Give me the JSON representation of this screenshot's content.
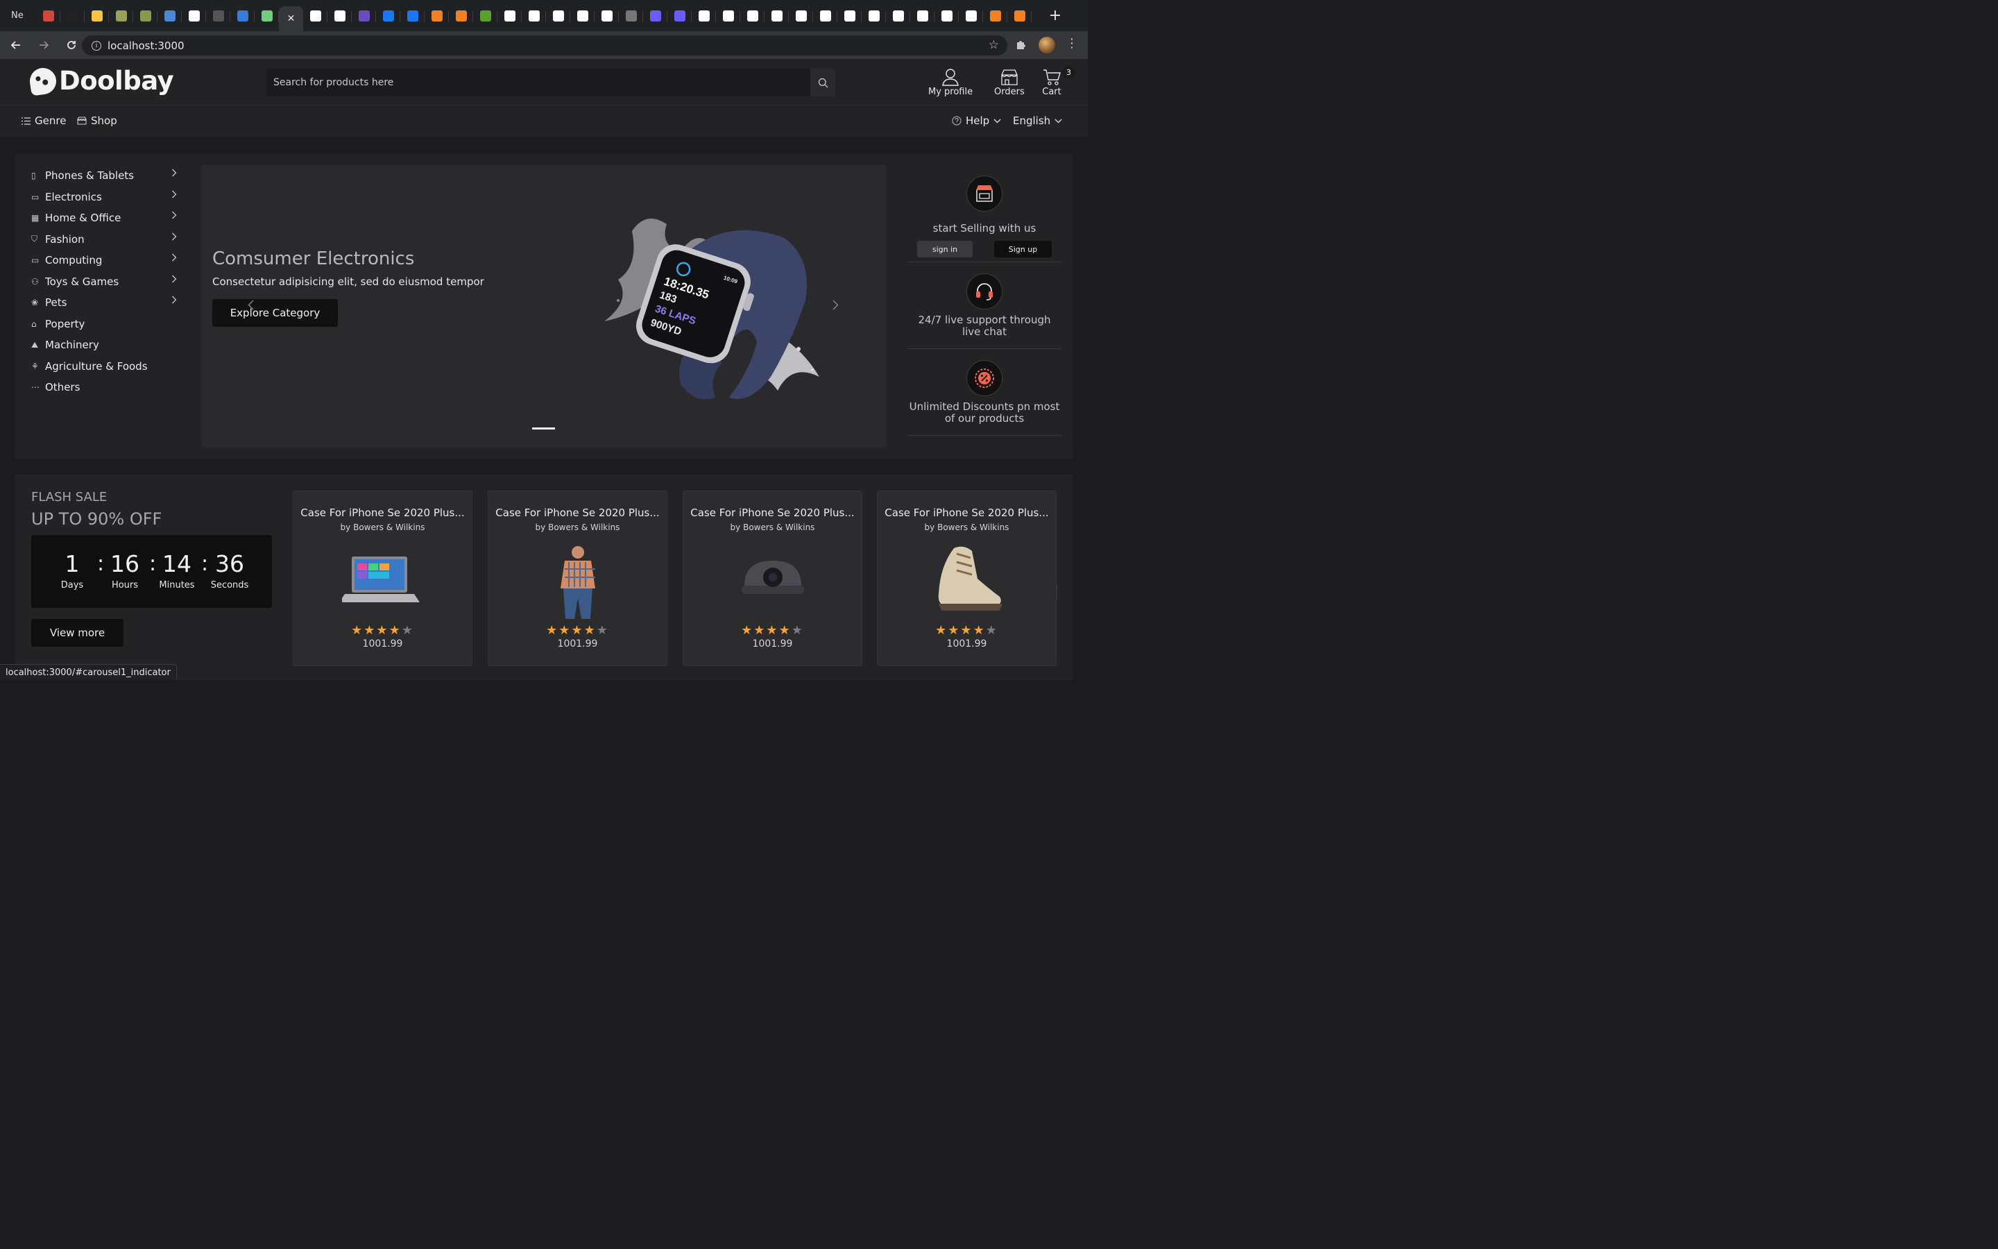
{
  "browser": {
    "first_tab_label": "Ne",
    "url": "localhost:3000",
    "status_url": "localhost:3000/#carousel1_indicator",
    "tab_favicon_colors": [
      "#d44638",
      "#222",
      "#f6c343",
      "#9aa05a",
      "#8b9a4a",
      "#4a8ad4",
      "#ffffff",
      "#555",
      "#3a7bd5",
      "#6fcf7c",
      "#ffffff",
      "#ffffff",
      "#ffffff",
      "#6a4bc4",
      "#1877f2",
      "#1877f2",
      "#f48024",
      "#f48024",
      "#5aa02c",
      "#ffffff",
      "#ffffff",
      "#ffffff",
      "#ffffff",
      "#ffffff",
      "#777",
      "#6b5bff",
      "#6b5bff",
      "#ffffff",
      "#ffffff",
      "#ffffff",
      "#ffffff",
      "#ffffff",
      "#ffffff",
      "#ffffff",
      "#ffffff",
      "#ffffff",
      "#ffffff",
      "#ffffff",
      "#ffffff",
      "#f48024",
      "#f48024"
    ]
  },
  "site": {
    "brand": "Doolbay",
    "search_placeholder": "Search for products here",
    "header": {
      "profile": "My profile",
      "orders": "Orders",
      "cart": "Cart",
      "cart_count": "3"
    },
    "subnav": {
      "genre": "Genre",
      "shop": "Shop",
      "help": "Help",
      "language": "English"
    }
  },
  "categories": [
    {
      "label": "Phones & Tablets",
      "icon": "phone-icon",
      "glyph": "▯",
      "has_sub": true
    },
    {
      "label": "Electronics",
      "icon": "monitor-icon",
      "glyph": "▭",
      "has_sub": true
    },
    {
      "label": "Home & Office",
      "icon": "building-icon",
      "glyph": "▦",
      "has_sub": true
    },
    {
      "label": "Fashion",
      "icon": "shirt-icon",
      "glyph": "⛉",
      "has_sub": true
    },
    {
      "label": "Computing",
      "icon": "laptop-icon",
      "glyph": "▭",
      "has_sub": true
    },
    {
      "label": "Toys & Games",
      "icon": "gamepad-icon",
      "glyph": "⚇",
      "has_sub": true
    },
    {
      "label": "Pets",
      "icon": "paw-icon",
      "glyph": "❀",
      "has_sub": true
    },
    {
      "label": "Poperty",
      "icon": "home-icon",
      "glyph": "⌂",
      "has_sub": false
    },
    {
      "label": "Machinery",
      "icon": "machine-icon",
      "glyph": "⛰",
      "has_sub": false
    },
    {
      "label": "Agriculture & Foods",
      "icon": "plant-icon",
      "glyph": "⚘",
      "has_sub": false
    },
    {
      "label": "Others",
      "icon": "dots-icon",
      "glyph": "⋯",
      "has_sub": false
    }
  ],
  "hero": {
    "title": "Comsumer Electronics",
    "subtitle": "Consectetur adipisicing elit, sed do eiusmod tempor",
    "cta": "Explore Category",
    "watch_readout": [
      "18:20.35",
      "183",
      "36 LAPS",
      "900YD",
      "10:09"
    ]
  },
  "perks": {
    "sell_text": "start Selling with us",
    "sign_in": "sign in",
    "sign_up": "Sign up",
    "support_text": "24/7 live support through live chat",
    "discount_text": "Unlimited Discounts pn most of our products"
  },
  "flash": {
    "label": "FLASH SALE",
    "headline": "UP TO 90% OFF",
    "days": "1",
    "hours": "16",
    "minutes": "14",
    "seconds": "36",
    "days_label": "Days",
    "hours_label": "Hours",
    "minutes_label": "Minutes",
    "seconds_label": "Seconds",
    "view_more": "View more"
  },
  "products": [
    {
      "title": "Case For iPhone Se 2020 Plus...",
      "by": "by Bowers & Wilkins",
      "price": "1001.99",
      "rating": 4,
      "image": "laptop"
    },
    {
      "title": "Case For iPhone Se 2020 Plus...",
      "by": "by Bowers & Wilkins",
      "price": "1001.99",
      "rating": 4,
      "image": "shirt-man"
    },
    {
      "title": "Case For iPhone Se 2020 Plus...",
      "by": "by Bowers & Wilkins",
      "price": "1001.99",
      "rating": 4,
      "image": "security-camera"
    },
    {
      "title": "Case For iPhone Se 2020 Plus...",
      "by": "by Bowers & Wilkins",
      "price": "1001.99",
      "rating": 4,
      "image": "sneaker"
    }
  ]
}
